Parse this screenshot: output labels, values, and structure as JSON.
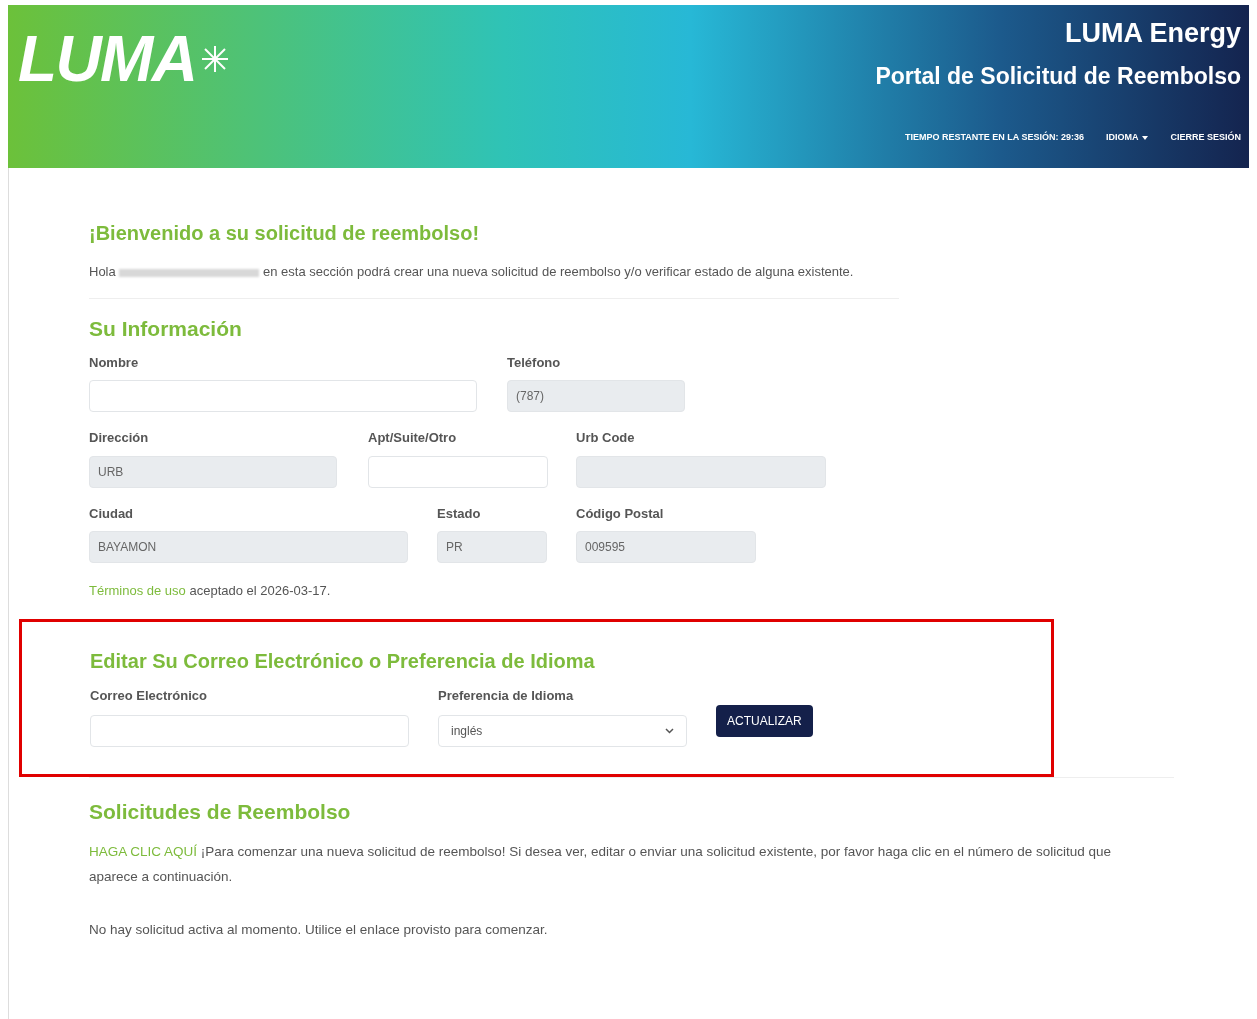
{
  "header": {
    "logo": "LUMA",
    "company": "LUMA Energy",
    "portal_title": "Portal de Solicitud de Reembolso",
    "nav": [
      {
        "label": "TIEMPO RESTANTE EN LA SESIÓN: 29:36",
        "kind": "text"
      },
      {
        "label": "IDIOMA",
        "kind": "dropdown"
      },
      {
        "label": "CIERRE SESIÓN",
        "kind": "link"
      }
    ]
  },
  "welcome": {
    "title": "¡Bienvenido a su solicitud de reembolso!",
    "greeting": "Hola",
    "message": "en esta sección podrá crear una nueva solicitud de reembolso y/o verificar estado de alguna existente."
  },
  "info": {
    "title": "Su Información",
    "rows": [
      [
        {
          "label": "Nombre",
          "disabled": false
        },
        {
          "label": "Teléfono",
          "value": "(787)",
          "disabled": true
        }
      ],
      [
        {
          "label": "Dirección",
          "value": "URB",
          "disabled": true
        },
        {
          "label": "Apt/Suite/Otro",
          "disabled": false
        },
        {
          "label": "Urb Code",
          "disabled": true
        }
      ],
      [
        {
          "label": "Ciudad",
          "value": "BAYAMON",
          "disabled": true
        },
        {
          "label": "Estado",
          "value": "PR",
          "disabled": true
        },
        {
          "label": "Código Postal",
          "value": "009595",
          "disabled": true
        }
      ]
    ],
    "terms_link": "Términos de uso",
    "terms_text": "aceptado el 2026-03-17."
  },
  "edit": {
    "highlighted": true,
    "title": "Editar Su Correo Electrónico o Preferencia de Idioma",
    "email_label": "Correo Electrónico",
    "language_label": "Preferencia de Idioma",
    "language_value": "inglés",
    "button": "ACTUALIZAR"
  },
  "requests": {
    "title": "Solicitudes de Reembolso",
    "link": "HAGA CLIC AQUÍ",
    "text": "¡Para comenzar una nueva solicitud de reembolso! Si desea ver, editar o enviar una solicitud existente, por favor haga clic en el número de solicitud que aparece a continuación.",
    "empty": "No hay solicitud activa al momento. Utilice el enlace provisto para comenzar."
  }
}
